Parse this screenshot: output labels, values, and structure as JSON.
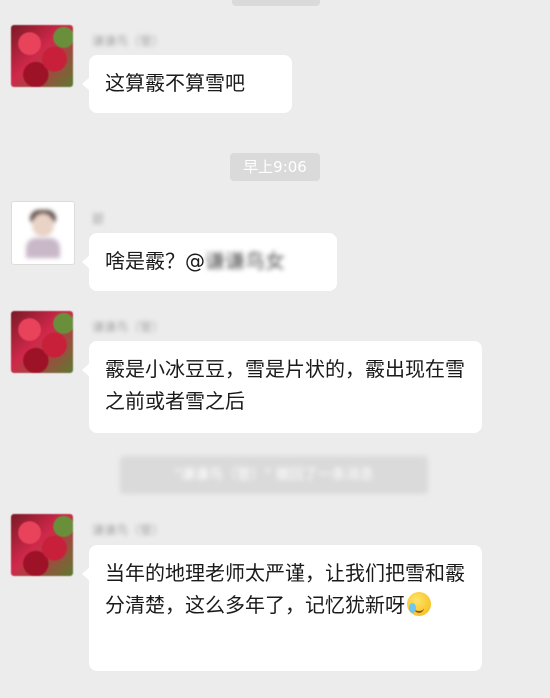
{
  "messages": [
    {
      "nickname": "谦谦鸟（管）",
      "text": "这算霰不算雪吧"
    },
    {
      "nickname": "碧",
      "text": "啥是霰？@",
      "mention": "谦谦鸟女"
    },
    {
      "nickname": "谦谦鸟（管）",
      "text": "霰是小冰豆豆，雪是片状的，霰出现在雪之前或者雪之后"
    },
    {
      "nickname": "谦谦鸟（管）",
      "text": "当年的地理老师太严谨，让我们把雪和霰分清楚，这么多年了，记忆犹新呀"
    }
  ],
  "timestamp": "早上9:06",
  "system_notice": "\"谦谦鸟（管）\" 撤回了一条消息",
  "icons": {
    "cry_laugh_emoji": "face-with-tears-of-joy-icon"
  }
}
